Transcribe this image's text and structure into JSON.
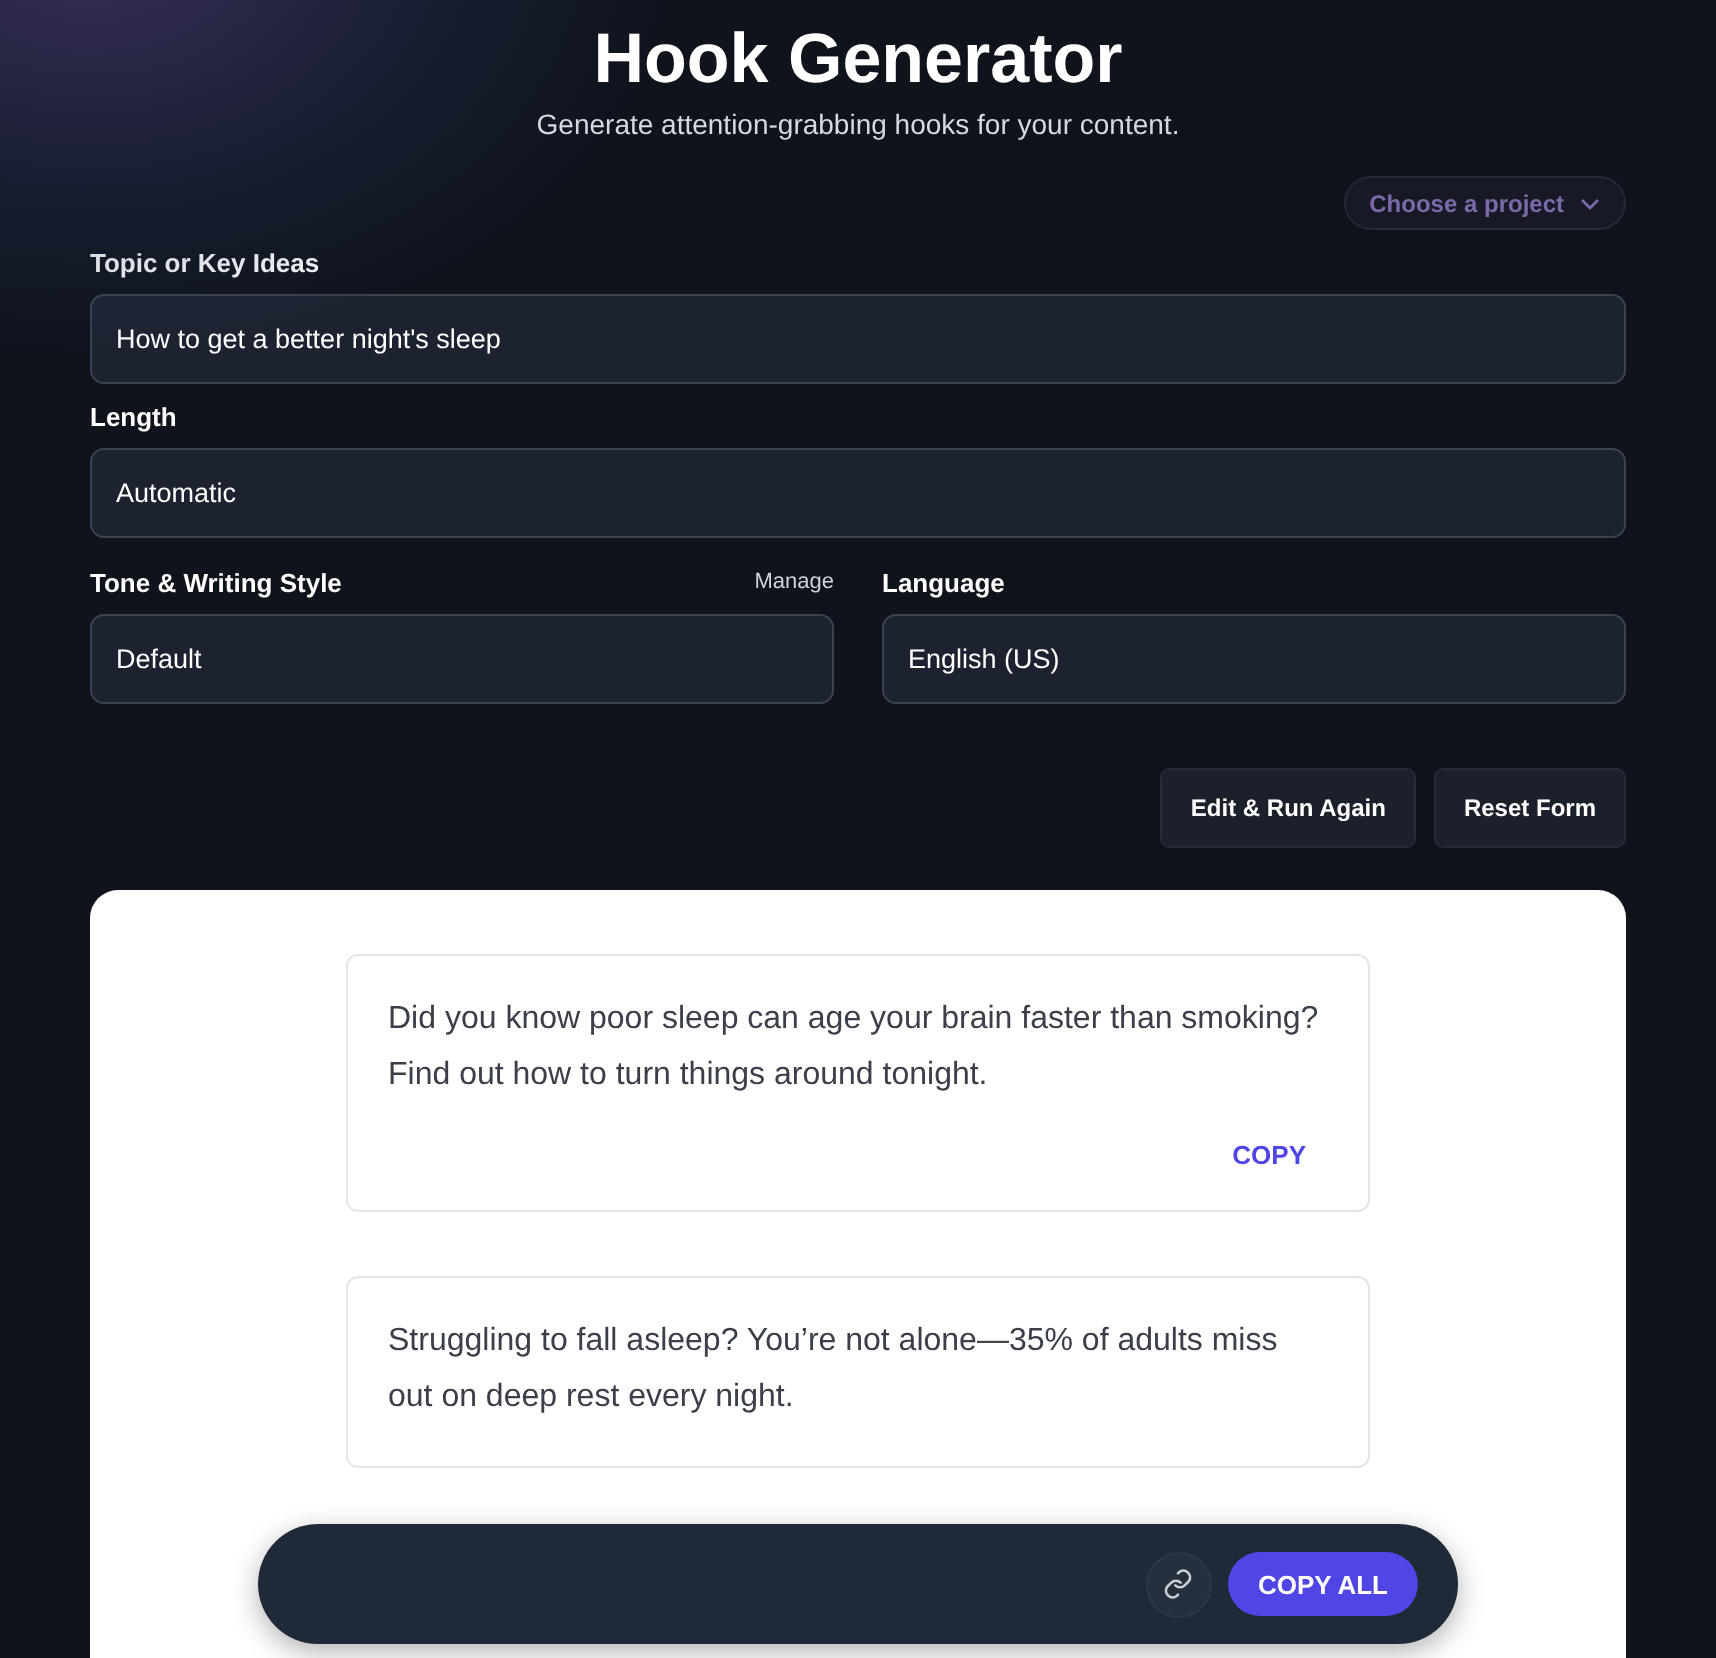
{
  "header": {
    "title": "Hook Generator",
    "subtitle": "Generate attention-grabbing hooks for your content."
  },
  "project_picker": {
    "label": "Choose a project"
  },
  "fields": [
    {
      "label": "Topic or Key Ideas",
      "value": "How to get a better night's sleep"
    },
    {
      "label": "Length",
      "value": "Automatic"
    }
  ],
  "row_fields": [
    {
      "label": "Tone & Writing Style",
      "action": "Manage",
      "value": "Default"
    },
    {
      "label": "Language",
      "value": "English (US)"
    }
  ],
  "buttons": [
    "Edit & Run Again",
    "Reset Form"
  ],
  "hooks": [
    {
      "text": "Did you know poor sleep can age your brain faster than smoking? Find out how to turn things around tonight.",
      "copy": "COPY"
    },
    {
      "text": "Struggling to fall asleep? You’re not alone—35% of adults miss out on deep rest every night."
    }
  ],
  "bottom_bar": {
    "copy_all": "COPY ALL"
  }
}
